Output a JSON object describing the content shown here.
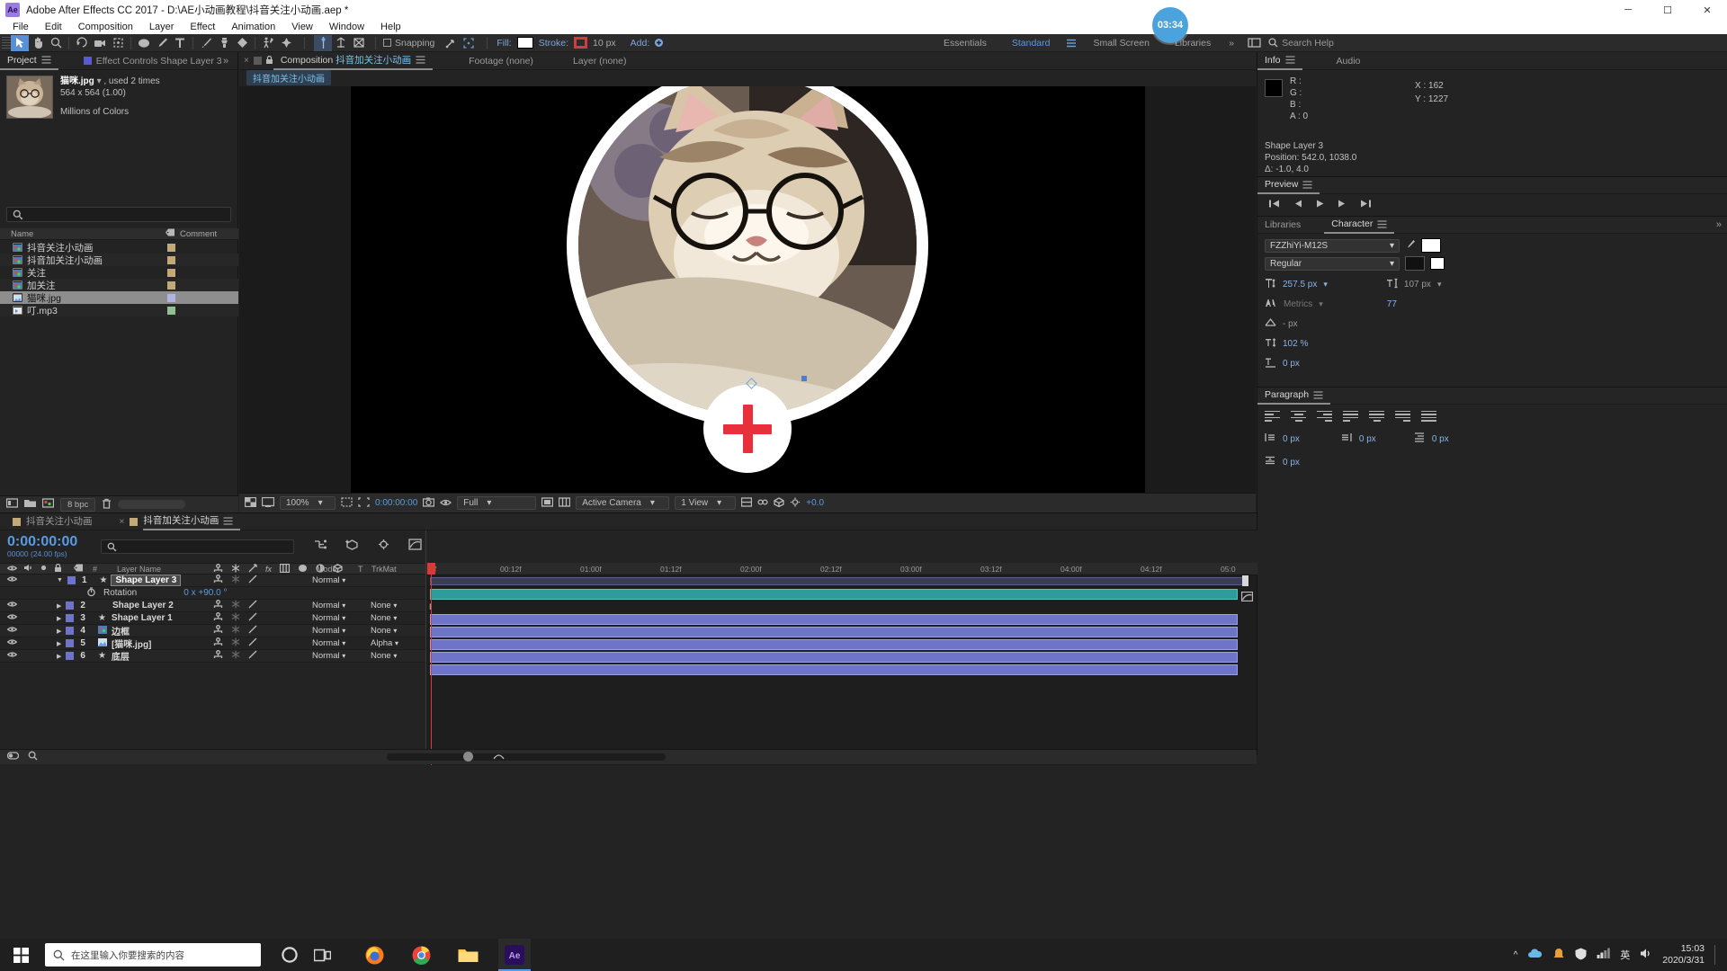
{
  "titlebar": {
    "app_badge": "Ae",
    "title": "Adobe After Effects CC 2017 - D:\\AE小动画教程\\抖音关注小动画.aep *",
    "minimize": "─",
    "maximize": "☐",
    "close": "✕"
  },
  "menubar": {
    "items": [
      "File",
      "Edit",
      "Composition",
      "Layer",
      "Effect",
      "Animation",
      "View",
      "Window",
      "Help"
    ]
  },
  "toolbar": {
    "snapping_label": "Snapping",
    "fill_label": "Fill:",
    "stroke_label": "Stroke:",
    "stroke_width": "10 px",
    "add_label": "Add:",
    "fill_color": "#ffffff",
    "stroke_color": "#d23c3c",
    "workspaces": [
      "Essentials",
      "Standard",
      "Small Screen",
      "Libraries"
    ],
    "workspace_selected": "Standard",
    "overflow": "»",
    "search_help": "Search Help",
    "time_bubble": "03:34"
  },
  "project": {
    "tab_label": "Project",
    "effect_controls_tab": "Effect Controls Shape Layer 3",
    "collapse": "»",
    "asset": {
      "name": "猫咪.jpg",
      "usage": ", used 2 times",
      "dimensions": "564 x 564 (1.00)",
      "colors": "Millions of Colors"
    },
    "search_placeholder": "",
    "columns": [
      "Name",
      "Comment"
    ],
    "items": [
      {
        "name": "抖音关注小动画",
        "type": "comp",
        "swatch": "#c3a878",
        "selected": false
      },
      {
        "name": "抖音加关注小动画",
        "type": "comp",
        "swatch": "#c3a878",
        "selected": false
      },
      {
        "name": "关注",
        "type": "comp",
        "swatch": "#c3a878",
        "selected": false
      },
      {
        "name": "加关注",
        "type": "comp",
        "swatch": "#c3a878",
        "selected": false
      },
      {
        "name": "猫咪.jpg",
        "type": "image",
        "swatch": "#b3b3e0",
        "selected": true
      },
      {
        "name": "叮.mp3",
        "type": "audio",
        "swatch": "#8fc08f",
        "selected": false
      }
    ],
    "footer": {
      "bpc": "8 bpc"
    }
  },
  "composition": {
    "tabs": [
      {
        "label": "Composition 抖音加关注小动画",
        "active": true
      },
      {
        "label": "Footage (none)",
        "active": false
      },
      {
        "label": "Layer (none)",
        "active": false
      }
    ],
    "breadcrumb": "抖音加关注小动画",
    "bottom": {
      "zoom": "100%",
      "time": "0:00:00:00",
      "resolution": "Full",
      "camera": "Active Camera",
      "views": "1 View",
      "exposure": "+0.0"
    }
  },
  "info_panel": {
    "tabs": [
      "Info",
      "Audio"
    ],
    "channels": [
      "R :",
      "G :",
      "B :",
      "A : 0"
    ],
    "x": "X : 162",
    "y": "Y : 1227",
    "layer_name": "Shape Layer 3",
    "position": "Position: 542.0, 1038.0",
    "delta": "Δ: -1.0, 4.0"
  },
  "preview_panel": {
    "title": "Preview"
  },
  "character_panel": {
    "tabs": [
      "Libraries",
      "Character"
    ],
    "font_family": "FZZhiYi-M12S",
    "font_style": "Regular",
    "font_size": "257.5 px",
    "leading": "107 px",
    "kerning": "Metrics",
    "tracking": "77",
    "stroke_width": "- px",
    "vertical_scale": "102 %",
    "baseline_shift": "0 px",
    "ime": "英"
  },
  "paragraph_panel": {
    "title": "Paragraph",
    "indent_left": "0 px",
    "indent_right": "0 px",
    "indent_first": "0 px",
    "space_before": "0 px",
    "space_after": "0 px"
  },
  "timeline": {
    "tabs": [
      {
        "label": "抖音关注小动画",
        "active": false
      },
      {
        "label": "抖音加关注小动画",
        "active": true
      }
    ],
    "current_time": "0:00:00:00",
    "frame_info": "00000 (24.00 fps)",
    "search_placeholder": "",
    "columns": [
      "#",
      "Layer Name",
      "Mode",
      "T",
      "TrkMat"
    ],
    "ruler_labels": [
      "0f",
      "00:12f",
      "01:00f",
      "01:12f",
      "02:00f",
      "02:12f",
      "03:00f",
      "03:12f",
      "04:00f",
      "04:12f",
      "05:0"
    ],
    "layers": [
      {
        "num": "1",
        "name": "Shape Layer 3",
        "mode": "Normal",
        "trkmat": "",
        "selected": true,
        "expanded": true,
        "color": "#6e74c8",
        "bar_color": "#2f9c9c"
      },
      {
        "num": "2",
        "name": "Shape Layer 2",
        "mode": "Normal",
        "trkmat": "None",
        "selected": false,
        "expanded": false,
        "color": "#6e74c8",
        "bar_color": "#6e74c8"
      },
      {
        "num": "3",
        "name": "Shape Layer 1",
        "mode": "Normal",
        "trkmat": "None",
        "selected": false,
        "expanded": false,
        "color": "#6e74c8",
        "bar_color": "#6e74c8"
      },
      {
        "num": "4",
        "name": "边框",
        "mode": "Normal",
        "trkmat": "None",
        "selected": false,
        "expanded": false,
        "color": "#6e74c8",
        "bar_color": "#6e74c8"
      },
      {
        "num": "5",
        "name": "[猫咪.jpg]",
        "mode": "Normal",
        "trkmat": "Alpha",
        "selected": false,
        "expanded": false,
        "color": "#6e74c8",
        "bar_color": "#6e74c8"
      },
      {
        "num": "6",
        "name": "底层",
        "mode": "Normal",
        "trkmat": "None",
        "selected": false,
        "expanded": false,
        "color": "#6e74c8",
        "bar_color": "#6e74c8"
      }
    ],
    "property": {
      "name": "Rotation",
      "value": "0 x +90.0 °"
    }
  },
  "taskbar": {
    "search_placeholder": "在这里输入你要搜索的内容",
    "ime": "英",
    "time": "15:03",
    "date": "2020/3/31",
    "apps": [
      "cortana",
      "task-view",
      "firefox",
      "chrome",
      "explorer",
      "after-effects"
    ]
  }
}
